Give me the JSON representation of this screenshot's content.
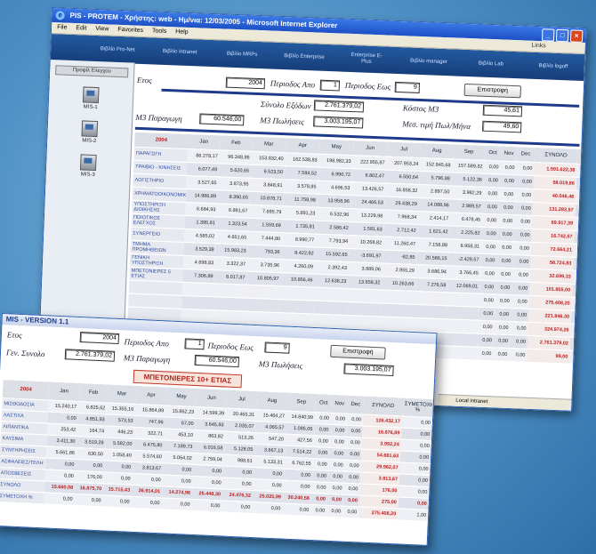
{
  "back_window": {
    "title": "PIS - PROTEM - Χρήστης: web - Ημ/νια: 12/03/2005 - Microsoft Internet Explorer",
    "menu": [
      "File",
      "Edit",
      "View",
      "Favorites",
      "Tools",
      "Help"
    ],
    "links_label": "Links",
    "nav": [
      "Βιβλίο Pro-Net",
      "Βιβλίο Intranet",
      "Βιβλίο MRPs",
      "Βιβλίο Enterprise",
      "Enterprise E-Plus",
      "Βιβλίο manager",
      "Βιβλίο Lab",
      "Βιβλίο logoff"
    ],
    "left_header": "Προφίλ Ελεγχου",
    "mis_items": [
      "MIS-1",
      "MIS-2",
      "MIS-3"
    ],
    "form": {
      "etos_label": "Ετος",
      "etos_value": "2004",
      "period_from_label": "Περιοδος Απο",
      "period_from_value": "1",
      "period_to_label": "Περιοδος Εως",
      "period_to_value": "9",
      "return_button": "Επιστροφή",
      "total_expenses_label": "Σύνολο Εξόδων",
      "total_expenses_value": "2.761.379,02",
      "cost_m3_label": "Κόστος Μ3",
      "cost_m3_value": "45,61",
      "production_label": "Μ3 Παραγωγη",
      "production_value": "60.546,00",
      "sales_label": "Μ3 Πωλήσεις",
      "sales_value": "3.003.195,07",
      "avg_price_label": "Μεσ. τιμή Πωλ/Μήνα",
      "avg_price_value": "49,60"
    },
    "table": {
      "headers": [
        "2004",
        "Jan",
        "Feb",
        "Mar",
        "Apr",
        "May",
        "Jun",
        "Jul",
        "Aug",
        "Sep",
        "Oct",
        "Nov",
        "Dec",
        "ΣΥΝΟΛΟ",
        "ΣΥ"
      ],
      "rows": [
        {
          "label": "ΠΑΡΑΓΩΓΗ",
          "values": [
            "86.278,17",
            "96.348,86",
            "153.832,40",
            "162.538,83",
            "198.982,33",
            "222.955,87",
            "207.953,24",
            "152.845,68",
            "157.589,32",
            "0,00",
            "0,00",
            "0,00"
          ],
          "total": "1.591.622,38"
        },
        {
          "label": "ΤΡΑΙΒΙΟ - ΚΙΝΗΣΕΙΣ",
          "values": [
            "6.077,49",
            "5.620,65",
            "6.523,50",
            "7.584,52",
            "6.990,72",
            "6.802,47",
            "6.550,64",
            "5.796,88",
            "5.122,36",
            "0,00",
            "0,00",
            "0,00"
          ],
          "total": "58.019,86"
        },
        {
          "label": "ΛΟΓΙΣΤΗΡΙΟ",
          "values": [
            "3.527,65",
            "3.873,95",
            "3.848,91",
            "3.578,85",
            "4.696,53",
            "13.426,57",
            "16.858,32",
            "2.897,50",
            "3.982,29",
            "0,00",
            "0,00",
            "0,00"
          ],
          "total": "40.046,46"
        },
        {
          "label": "ΧΡΗΜΑΤΟΟΙΚΟΝΟΜΙΚΑ",
          "values": [
            "14.986,89",
            "8.390,65",
            "10.878,71",
            "11.758,98",
            "13.958,96",
            "24.466,53",
            "29.438,29",
            "14.088,96",
            "2.989,57",
            "0,00",
            "0,00",
            "0,00"
          ],
          "total": "131.283,57"
        },
        {
          "label": "ΥΠΟΣΤΗΡΙΞΗ ΔΙΟΙΚΗΣΗΣ",
          "values": [
            "6.684,93",
            "6.891,67",
            "7.695,79",
            "5.891,23",
            "6.532,96",
            "13.229,98",
            "7.968,34",
            "2.414,17",
            "6.478,45",
            "0,00",
            "0,00",
            "0,00"
          ],
          "total": "69.917,39"
        },
        {
          "label": "ΠΟΙΟΤΙΚΟΣ ΕΛΕΓΧΟΣ",
          "values": [
            "1.395,81",
            "1.323,54",
            "1.559,69",
            "1.735,81",
            "2.586,42",
            "1.581,63",
            "2.712,42",
            "1.621,42",
            "2.225,82",
            "0,00",
            "0,00",
            "0,00"
          ],
          "total": "16.742,57"
        },
        {
          "label": "ΣΥΝΕΡΓΕΙΟ",
          "values": [
            "4.585,02",
            "4.651,65",
            "7.444,80",
            "8.990,77",
            "7.793,94",
            "10.268,82",
            "11.260,47",
            "7.158,88",
            "8.958,31",
            "0,00",
            "0,00",
            "0,00"
          ],
          "total": "72.664,21"
        },
        {
          "label": "ΤΜΗΜΑ ΠΡΟΜΗΘΕΙΩΝ",
          "values": [
            "3.529,38",
            "15.983,23",
            "793,36",
            "8.422,92",
            "15.592,65",
            "-3.691,97",
            "-82,85",
            "20.586,15",
            "-2.429,57",
            "0,00",
            "0,00",
            "0,00"
          ],
          "total": "58.724,83"
        },
        {
          "label": "ΓΕΝΙΚΗ ΥΠΟΣΤΗΡΙΞΗ",
          "values": [
            "4.698,83",
            "3.322,37",
            "3.735,96",
            "4.260,09",
            "2.392,43",
            "3.889,06",
            "2.955,29",
            "3.686,94",
            "3.766,45",
            "0,00",
            "0,00",
            "0,00"
          ],
          "total": "32.699,33"
        },
        {
          "label": "ΜΠΕΤΟΝΙΕΡΕΣ 5 ΕΤΙΑΣ",
          "values": [
            "7.306,89",
            "8.017,87",
            "10.805,97",
            "10.856,46",
            "12.638,23",
            "13.658,32",
            "10.263,66",
            "7.276,58",
            "12.069,01",
            "0,00",
            "0,00",
            "0,00"
          ],
          "total": "101.855,00"
        },
        {
          "label": "",
          "values": [
            "",
            "",
            "",
            "",
            "",
            "",
            "",
            "",
            "",
            "0,00",
            "0,00",
            "0,00"
          ],
          "total": "275.408,20"
        },
        {
          "label": "",
          "values": [
            "",
            "",
            "",
            "",
            "",
            "",
            "",
            "",
            "",
            "0,00",
            "0,00",
            "0,00"
          ],
          "total": "221.846,30"
        },
        {
          "label": "",
          "values": [
            "",
            "",
            "",
            "",
            "",
            "",
            "",
            "",
            "",
            "0,00",
            "0,00",
            "0,00"
          ],
          "total": "324.974,26"
        },
        {
          "label": "",
          "values": [
            "",
            "",
            "",
            "",
            "",
            "",
            "",
            "",
            "",
            "0,00",
            "0,00",
            "0,00"
          ],
          "total": "2.761.379,02"
        },
        {
          "label": "",
          "values": [
            "",
            "",
            "",
            "",
            "",
            "",
            "",
            "",
            "",
            "0,00",
            "0,00",
            "0,00"
          ],
          "total": "99,00"
        }
      ]
    },
    "status": "Local intranet"
  },
  "front_window": {
    "title": "MIS - VERSION 1.1",
    "etos_label": "Ετος",
    "etos_value": "2004",
    "period_from_label": "Περιοδος Απο",
    "period_from_value": "1",
    "period_to_label": "Περιοδος Εως",
    "period_to_value": "9",
    "return_button": "Επιστροφή",
    "gen_total_label": "Γεν. Συνολο",
    "gen_total_value": "2.761.379,02",
    "production_label": "Μ3 Παραγωγη",
    "production_value": "60.546,00",
    "sales_label": "Μ3 Πωλήσεις",
    "sales_value": "3.003.195,07",
    "section_title": "ΜΠΕΤΟΝΙΕΡΕΣ 10+ ΕΤΙΑΣ",
    "table": {
      "headers": [
        "2004",
        "Jan",
        "Feb",
        "Mar",
        "Apr",
        "May",
        "Jun",
        "Jul",
        "Aug",
        "Sep",
        "Oct",
        "Nov",
        "Dec",
        "ΣΥΝΟΛΟ",
        "ΣΥΜΕΤΟΧΗ %"
      ],
      "rows": [
        {
          "label": "ΜΙΣΘΟΔΟΣΙΑ",
          "values": [
            "15.240,17",
            "6.825,62",
            "15.355,16",
            "15.864,89",
            "15.862,23",
            "14.599,39",
            "20.465,31",
            "15.464,27",
            "14.840,99",
            "0,00",
            "0,00",
            "0,00"
          ],
          "total": "126.432,17",
          "share": "0,00"
        },
        {
          "label": "ΛΑΣΤΙΧΑ",
          "values": [
            "0,00",
            "4.851,93",
            "573,53",
            "747,96",
            "67,00",
            "3.645,83",
            "2.035,07",
            "4.065,57",
            "1.085,05",
            "0,00",
            "0,00",
            "0,00"
          ],
          "total": "16.876,89",
          "share": "0,00"
        },
        {
          "label": "ΛΙΠΑΝΤΙΚΑ",
          "values": [
            "253,42",
            "164,74",
            "446,23",
            "322,71",
            "453,10",
            "863,82",
            "513,26",
            "547,20",
            "427,56",
            "0,00",
            "0,00",
            "0,00"
          ],
          "total": "3.992,24",
          "share": "0,00"
        },
        {
          "label": "ΚΑΥΣΙΜΑ",
          "values": [
            "3.411,30",
            "3.519,28",
            "5.582,00",
            "6.475,80",
            "7.189,73",
            "6.016,58",
            "5.128,05",
            "3.667,13",
            "7.514,22",
            "0,00",
            "0,00",
            "0,00"
          ],
          "total": "54.661,63",
          "share": "0,00"
        },
        {
          "label": "ΣΥΝΤΗΡΗΣΕΙΣ",
          "values": [
            "5.661,86",
            "630,50",
            "1.058,40",
            "5.574,60",
            "5.064,02",
            "2.759,04",
            "988,61",
            "5.133,31",
            "6.762,55",
            "0,00",
            "0,00",
            "0,00"
          ],
          "total": "29.962,07",
          "share": "0,00"
        },
        {
          "label": "ΑΣΦΑΛΕΙΕΣ/ΤΕΛΗ",
          "values": [
            "0,00",
            "0,00",
            "0,00",
            "3.813,67",
            "0,00",
            "0,00",
            "0,00",
            "0,00",
            "0,00",
            "0,00",
            "0,00",
            "0,00"
          ],
          "total": "3.813,67",
          "share": "0,00"
        },
        {
          "label": "ΑΠΟΣΒΕΣΕΙΣ",
          "values": [
            "0,00",
            "176,00",
            "0,00",
            "0,00",
            "0,00",
            "0,00",
            "0,00",
            "0,00",
            "0,00",
            "0,00",
            "0,00",
            "0,00"
          ],
          "total": "176,00",
          "share": "0,00"
        },
        {
          "label": "ΣΥΝΟΛΟ",
          "values": [
            "15.660,08",
            "16.875,70",
            "15.715,43",
            "26.914,01",
            "14.274,96",
            "25.448,30",
            "24.476,32",
            "25.025,99",
            "30.240,56",
            "0,00",
            "0,00",
            "0,00"
          ],
          "total": "275,00",
          "share": "0,00"
        },
        {
          "label": "ΣΥΜΕΤΟΧΗ %",
          "values": [
            "0,00",
            "0,00",
            "0,00",
            "0,00",
            "0,00",
            "0,00",
            "0,00",
            "0,00",
            "0,00",
            "0,00",
            "0,00",
            "0,00"
          ],
          "total": "275.408,20",
          "share": "1,00"
        }
      ]
    }
  }
}
